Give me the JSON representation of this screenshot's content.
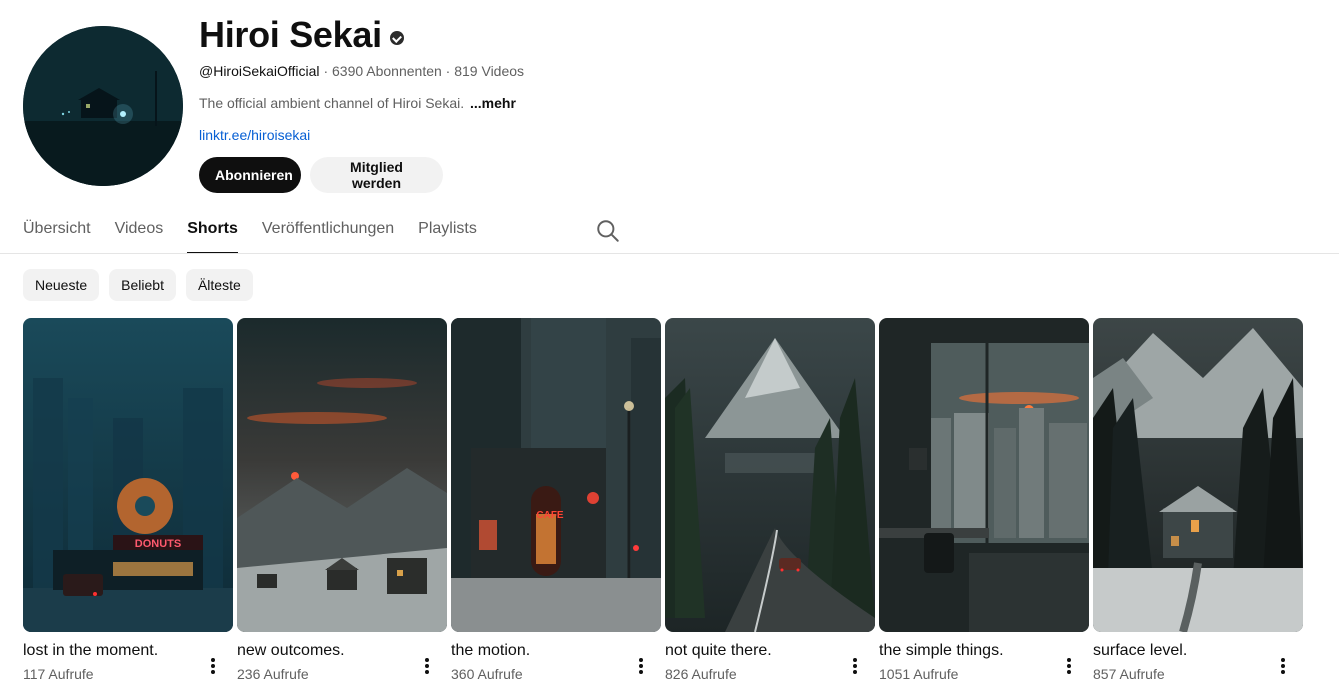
{
  "channel": {
    "name": "Hiroi Sekai",
    "handle": "@HiroiSekaiOfficial",
    "subscribers": "6390 Abonnenten",
    "videos": "819 Videos",
    "description": "The official ambient channel of Hiroi Sekai.",
    "more_label": "...mehr",
    "link": "linktr.ee/hiroisekai",
    "avatar_icon": "avatar-night-house"
  },
  "buttons": {
    "subscribe": "Abonnieren",
    "member": "Mitglied werden"
  },
  "tabs": [
    {
      "label": "Übersicht",
      "active": false
    },
    {
      "label": "Videos",
      "active": false
    },
    {
      "label": "Shorts",
      "active": true
    },
    {
      "label": "Veröffentlichungen",
      "active": false
    },
    {
      "label": "Playlists",
      "active": false
    }
  ],
  "filters": [
    {
      "label": "Neueste"
    },
    {
      "label": "Beliebt"
    },
    {
      "label": "Älteste"
    }
  ],
  "shorts": [
    {
      "title": "lost in the moment.",
      "views": "117 Aufrufe",
      "sign": "DONUTS"
    },
    {
      "title": "new outcomes.",
      "views": "236 Aufrufe"
    },
    {
      "title": "the motion.",
      "views": "360 Aufrufe",
      "sign": "CAFE"
    },
    {
      "title": "not quite there.",
      "views": "826 Aufrufe"
    },
    {
      "title": "the simple things.",
      "views": "1051 Aufrufe"
    },
    {
      "title": "surface level.",
      "views": "857 Aufrufe"
    }
  ],
  "colors": {
    "accent_dark": "#0f0f0f",
    "link": "#065fd4",
    "muted": "#606060",
    "chip_bg": "#f2f2f2"
  }
}
